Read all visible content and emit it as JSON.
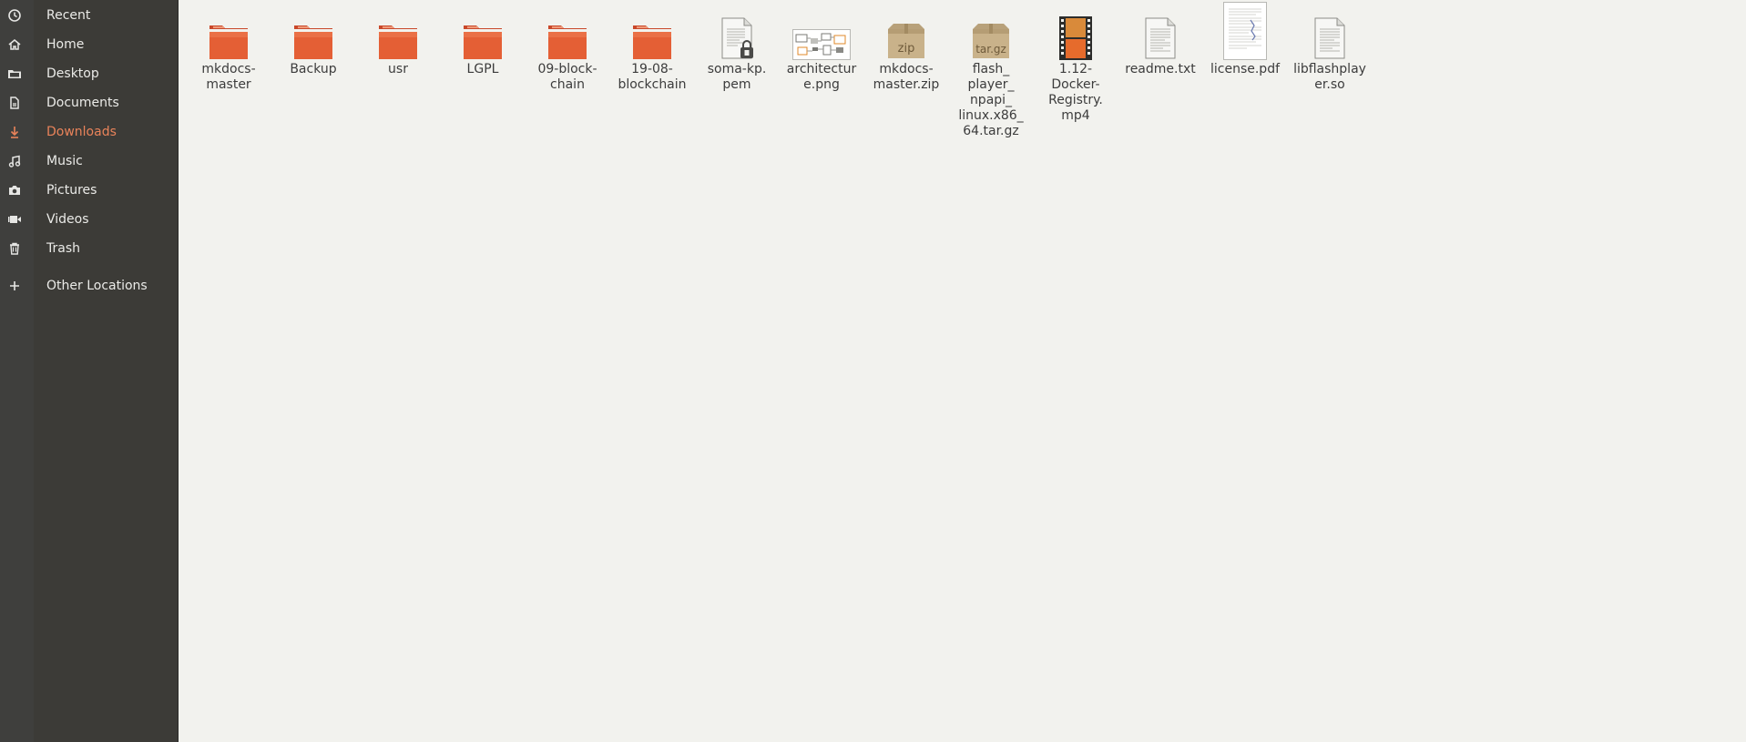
{
  "sidebar": {
    "items": [
      {
        "label": "Recent",
        "icon": "clock-icon"
      },
      {
        "label": "Home",
        "icon": "home-icon"
      },
      {
        "label": "Desktop",
        "icon": "desktop-icon"
      },
      {
        "label": "Documents",
        "icon": "document-icon"
      },
      {
        "label": "Downloads",
        "icon": "download-icon",
        "active": true
      },
      {
        "label": "Music",
        "icon": "music-icon"
      },
      {
        "label": "Pictures",
        "icon": "camera-icon"
      },
      {
        "label": "Videos",
        "icon": "video-icon"
      },
      {
        "label": "Trash",
        "icon": "trash-icon"
      },
      {
        "label": "Other Locations",
        "icon": "plus-icon"
      }
    ]
  },
  "files": [
    {
      "line1": "mkdocs-",
      "line2": "master",
      "type": "folder"
    },
    {
      "line1": "Backup",
      "line2": "",
      "type": "folder"
    },
    {
      "line1": "usr",
      "line2": "",
      "type": "folder"
    },
    {
      "line1": "LGPL",
      "line2": "",
      "type": "folder"
    },
    {
      "line1": "09-block-",
      "line2": "chain",
      "type": "folder"
    },
    {
      "line1": "19-08-",
      "line2": "blockchain",
      "type": "folder"
    },
    {
      "line1": "soma-kp.",
      "line2": "pem",
      "type": "pem"
    },
    {
      "line1": "architectur",
      "line2": "e.png",
      "type": "image"
    },
    {
      "line1": "mkdocs-",
      "line2": "master.zip",
      "type": "zip",
      "badge": "zip"
    },
    {
      "line1": "flash_",
      "line2": "player_",
      "line3": "npapi_",
      "line4": "linux.x86_",
      "line5": "64.tar.gz",
      "type": "archive",
      "badge": "tar.gz"
    },
    {
      "line1": "1.12-",
      "line2": "Docker-",
      "line3": "Registry.",
      "line4": "mp4",
      "type": "video"
    },
    {
      "line1": "readme.txt",
      "line2": "",
      "type": "text"
    },
    {
      "line1": "license.pdf",
      "line2": "",
      "type": "pdf"
    },
    {
      "line1": "libflashplay",
      "line2": "er.so",
      "type": "lib"
    }
  ],
  "colors": {
    "accent": "#e9835a",
    "folder": "#e05a2b"
  }
}
